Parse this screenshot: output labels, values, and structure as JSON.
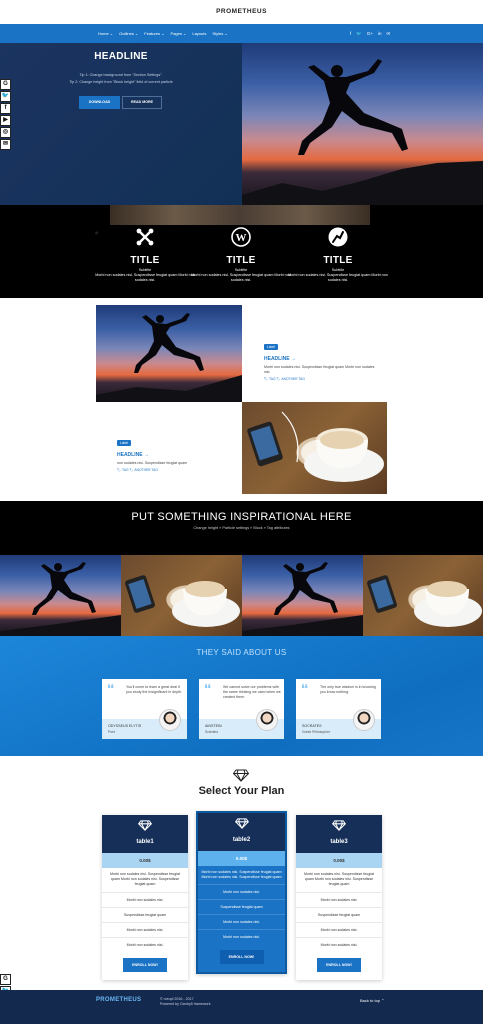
{
  "header": {
    "logo": "PROMETHEUS",
    "menu": [
      "Home ⌄",
      "Outlines ⌄",
      "Features ⌄",
      "Pages ⌄",
      "Layouts",
      "Styles ⌄"
    ],
    "social": [
      "f",
      "🐦",
      "G+",
      "in",
      "✉"
    ]
  },
  "hero": {
    "title": "HEADLINE",
    "tip1": "Tip 1: Change background from \"Section Settings\".",
    "tip2": "Tip 2: Change height from \"Block height\" field of current particle",
    "download_label": "DOWNLOAD",
    "readmore_label": "READ MORE"
  },
  "sidebar_social": [
    "G",
    "🐦",
    "f",
    "▶",
    "◎",
    "✉"
  ],
  "sidebar_social_bottom": [
    "G",
    "🐦",
    "f",
    "▶"
  ],
  "features": [
    {
      "icon": "joomla-icon",
      "title": "TITLE",
      "subtitle": "Subtitle",
      "text": "Morbi non sodales nisi. Suspendisse feugiat quam Morbi non sodales nisi."
    },
    {
      "icon": "wordpress-icon",
      "title": "TITLE",
      "subtitle": "Subtitle",
      "text": "Morbi non sodales nisi. Suspendisse feugiat quam Morbi non sodales nisi."
    },
    {
      "icon": "grav-icon",
      "title": "TITLE",
      "subtitle": "Subtitle",
      "text": "Morbi non sodales nisi. Suspendisse feugiat quam Morbi non sodales nisi."
    }
  ],
  "blog": [
    {
      "label": "Label",
      "title": "HEADLINE →",
      "text": "Morbi non sodales nisi. Suspendisse feugiat quam Morbi non sodales nisi.",
      "tags": "🏷 TAG  🏷 ANOTHER TAG"
    },
    {
      "label": "Label",
      "title": "HEADLINE →",
      "text": "non sodales nisi. Suspendisse feugiat quam",
      "tags": "🏷 TAG  🏷 ANOTHER TAG"
    }
  ],
  "banner": {
    "title": "PUT SOMETHING INSPIRATIONAL HERE",
    "subtitle": "Change height » Particle settings » Block » Tag attributes"
  },
  "testimonials": {
    "title": "THEY SAID ABOUT US",
    "items": [
      {
        "text": "You'll come to learn a great deal if you study the Insignificant in depth.",
        "name": "ODYSSEUS ELYTIS",
        "role": "Poet"
      },
      {
        "text": "We cannot solve our problems with the same thinking we used when we created them.",
        "name": "AINSTEIN",
        "role": "Scientist"
      },
      {
        "text": "The only true wisdom is in knowing you know nothing.",
        "name": "SOCRATES",
        "role": "Greek Philosopher"
      }
    ]
  },
  "plans": {
    "title": "Select Your Plan",
    "items": [
      {
        "name": "table1",
        "price": "0.00$",
        "desc": "Morbi non sodales nisi. Suspendisse feugiat quam Morbi non sodales nisi. Suspendisse feugiat quam",
        "rows": [
          "Morbi non sodales nisi.",
          "Suspendisse feugiat quam",
          "Morbi non sodales nisi.",
          "Morbi non sodales nisi."
        ],
        "button": "ENROLL NOW!"
      },
      {
        "name": "table2",
        "price": "0.00$",
        "desc": "Morbi non sodales nisi. Suspendisse feugiat quam Morbi non sodales nisi. Suspendisse feugiat quam",
        "rows": [
          "Morbi non sodales nisi.",
          "Suspendisse feugiat quam",
          "Morbi non sodales nisi.",
          "Morbi non sodales nisi."
        ],
        "button": "ENROLL NOW!"
      },
      {
        "name": "table3",
        "price": "0.00$",
        "desc": "Morbi non sodales nisi. Suspendisse feugiat quam Morbi non sodales nisi. Suspendisse feugiat quam",
        "rows": [
          "Morbi non sodales nisi.",
          "Suspendisse feugiat quam",
          "Morbi non sodales nisi.",
          "Morbi non sodales nisi."
        ],
        "button": "ENROLL NOW!"
      }
    ]
  },
  "footer": {
    "logo": "PROMETHEUS",
    "copyright": "© rzeupl 2016 - 2017",
    "powered": "Powered by Gantry5 framework",
    "back_to_top": "Back to top ⌃"
  },
  "colors": {
    "accent": "#1a73c4",
    "navy": "#152f58",
    "footer": "#13294d"
  }
}
